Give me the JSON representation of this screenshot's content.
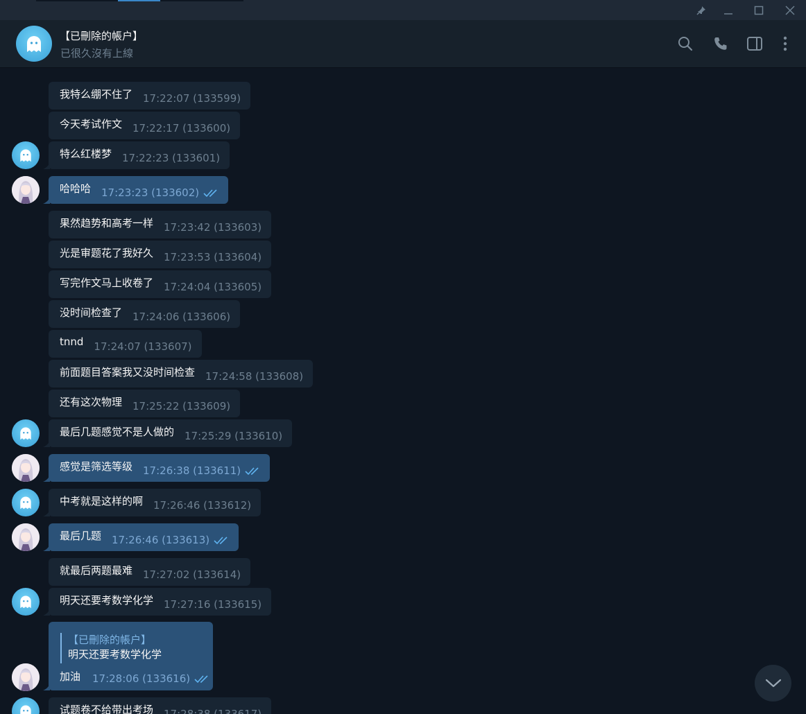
{
  "chat": {
    "name": "【已刪除的帳户】",
    "status": "已很久沒有上線"
  },
  "messages": [
    {
      "text": "我特么绷不住了",
      "meta": "17:22:07 (133599)"
    },
    {
      "text": "今天考试作文",
      "meta": "17:22:17 (133600)"
    },
    {
      "text": "特么红楼梦",
      "meta": "17:22:23 (133601)"
    },
    {
      "text": "哈哈哈",
      "meta": "17:23:23 (133602)"
    },
    {
      "text": "果然趋势和高考一样",
      "meta": "17:23:42 (133603)"
    },
    {
      "text": "光是审题花了我好久",
      "meta": "17:23:53 (133604)"
    },
    {
      "text": "写完作文马上收卷了",
      "meta": "17:24:04 (133605)"
    },
    {
      "text": "没时间检查了",
      "meta": "17:24:06 (133606)"
    },
    {
      "text": "tnnd",
      "meta": "17:24:07 (133607)"
    },
    {
      "text": "前面题目答案我又没时间检查",
      "meta": "17:24:58 (133608)"
    },
    {
      "text": "还有这次物理",
      "meta": "17:25:22 (133609)"
    },
    {
      "text": "最后几题感觉不是人做的",
      "meta": "17:25:29 (133610)"
    },
    {
      "text": "感觉是筛选等级",
      "meta": "17:26:38 (133611)"
    },
    {
      "text": "中考就是这样的啊",
      "meta": "17:26:46 (133612)"
    },
    {
      "text": "最后几题",
      "meta": "17:26:46 (133613)"
    },
    {
      "text": "就最后两题最难",
      "meta": "17:27:02 (133614)"
    },
    {
      "text": "明天还要考数学化学",
      "meta": "17:27:16 (133615)"
    },
    {
      "text": "试题卷不给带出考场",
      "meta": "17:28:38 (133617)"
    }
  ],
  "reply": {
    "quote_name": "【已刪除的帳户】",
    "quote_text": "明天还要考数学化学",
    "text": "加油",
    "meta": "17:28:06 (133616)"
  },
  "colors": {
    "background": "#0e1621",
    "incoming_bubble": "#182533",
    "outgoing_bubble": "#2b5278",
    "accent": "#5fb3f0"
  }
}
